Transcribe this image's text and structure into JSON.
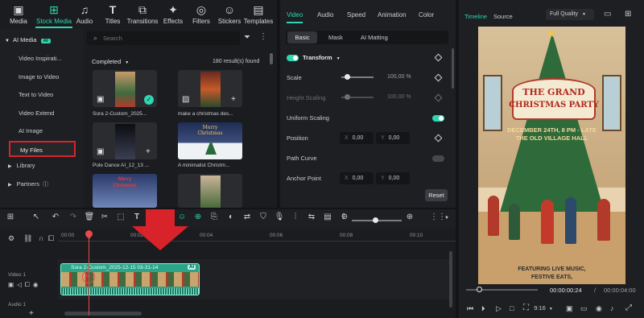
{
  "toolbar": {
    "items": [
      {
        "label": "Media",
        "icon": "media-icon"
      },
      {
        "label": "Stock Media",
        "icon": "stock-media-icon"
      },
      {
        "label": "Audio",
        "icon": "audio-icon"
      },
      {
        "label": "Titles",
        "icon": "titles-icon"
      },
      {
        "label": "Transitions",
        "icon": "transitions-icon"
      },
      {
        "label": "Effects",
        "icon": "effects-icon"
      },
      {
        "label": "Filters",
        "icon": "filters-icon"
      },
      {
        "label": "Stickers",
        "icon": "stickers-icon"
      },
      {
        "label": "Templates",
        "icon": "templates-icon"
      }
    ]
  },
  "sidebar": {
    "header": "AI Media",
    "header_badge": "AI",
    "items": [
      "Video Inspirati...",
      "Image to Video",
      "Text to Video",
      "Video Extend",
      "AI Image",
      "My Files"
    ],
    "library": "Library",
    "partners": "Partners"
  },
  "media": {
    "search_placeholder": "Search",
    "filter": "Completed",
    "result_count": "180 result(s) found",
    "items": [
      {
        "title": "Sora 2-Custom_2025..."
      },
      {
        "title": "make a christmas des..."
      },
      {
        "title": "Pole Dance AI_12_13 ..."
      },
      {
        "title": "A minimalist Christm..."
      }
    ],
    "thumb_text": {
      "merry": "Merry",
      "christmas": "Christmas"
    }
  },
  "properties": {
    "tabs": [
      "Video",
      "Audio",
      "Speed",
      "Animation",
      "Color"
    ],
    "subtabs": [
      "Basic",
      "Mask",
      "AI Matting"
    ],
    "section": "Transform",
    "scale_label": "Scale",
    "scale_value": "100,00",
    "scale_unit": "%",
    "height_label": "Height Scaling",
    "height_value": "100,00",
    "height_unit": "%",
    "uniform_label": "Uniform Scaling",
    "position_label": "Position",
    "pos_x_label": "X",
    "pos_x": "0,00",
    "pos_y_label": "Y",
    "pos_y": "0,00",
    "path_curve": "Path Curve",
    "anchor_label": "Anchor Point",
    "anchor_x_label": "X",
    "anchor_x": "0,00",
    "anchor_y_label": "Y",
    "anchor_y": "0,00",
    "reset": "Reset"
  },
  "preview": {
    "tab_timeline": "Timeline",
    "tab_source": "Source",
    "quality": "Full Quality",
    "poster": {
      "line1": "THE GRAND",
      "line2": "CHRISTMAS PARTY",
      "date": "DECEMBER 24TH, 8 PM - LATE",
      "venue": "THE OLD VILLAGE HALL",
      "feat1": "FEATURING LIVE MUSIC,",
      "feat2": "FESTIVE EATS,"
    },
    "current_time": "00:00:00:24",
    "separator": "/",
    "total_time": "00:00:04:00",
    "aspect": "9:16"
  },
  "timeline": {
    "ruler": [
      "00:00",
      "00:02",
      "00:04",
      "00:06",
      "00:08",
      "00:10"
    ],
    "clip_title": "Sora 2-Custom_2025-12-15 03-31-14",
    "clip_badge": "AI",
    "video_track": "Video 1",
    "audio_track": "Audio 1"
  },
  "colors": {
    "accent": "#2fd6b0",
    "highlight": "#d8232a",
    "playhead": "#e84a4a",
    "clip": "#2aa58a"
  }
}
